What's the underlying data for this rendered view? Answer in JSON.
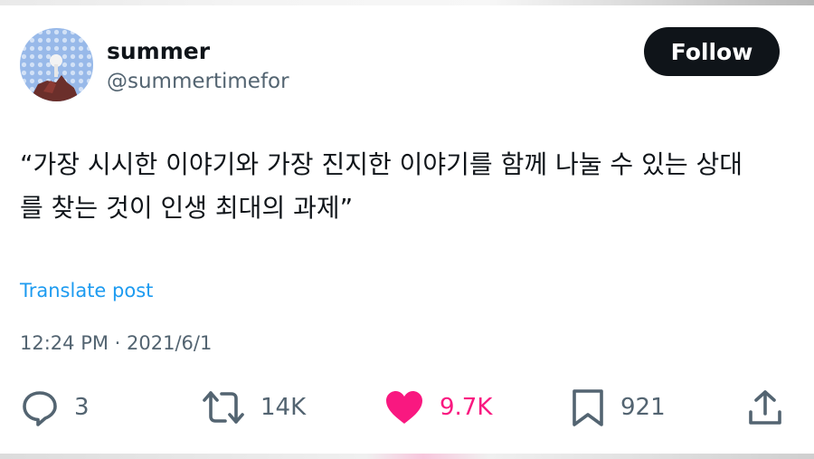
{
  "author": {
    "display_name": "summer",
    "handle": "@summertimefor"
  },
  "follow_button": {
    "label": "Follow"
  },
  "tweet": {
    "text": "“가장 시시한 이야기와 가장 진지한 이야기를 함께 나눌 수 있는 상대\n를 찾는 것이 인생 최대의 과제”",
    "translate_label": "Translate post",
    "timestamp": "12:24 PM · 2021/6/1"
  },
  "actions": {
    "replies": {
      "icon": "reply-icon",
      "count": "3"
    },
    "reposts": {
      "icon": "repost-icon",
      "count": "14K"
    },
    "likes": {
      "icon": "heart-icon",
      "count": "9.7K",
      "color": "#f91880"
    },
    "bookmarks": {
      "icon": "bookmark-icon",
      "count": "921"
    },
    "share": {
      "icon": "share-icon"
    }
  },
  "colors": {
    "text": "#0f1419",
    "secondary": "#536471",
    "link": "#1d9bf0",
    "like": "#f91880",
    "follow_bg": "#0f1419"
  }
}
